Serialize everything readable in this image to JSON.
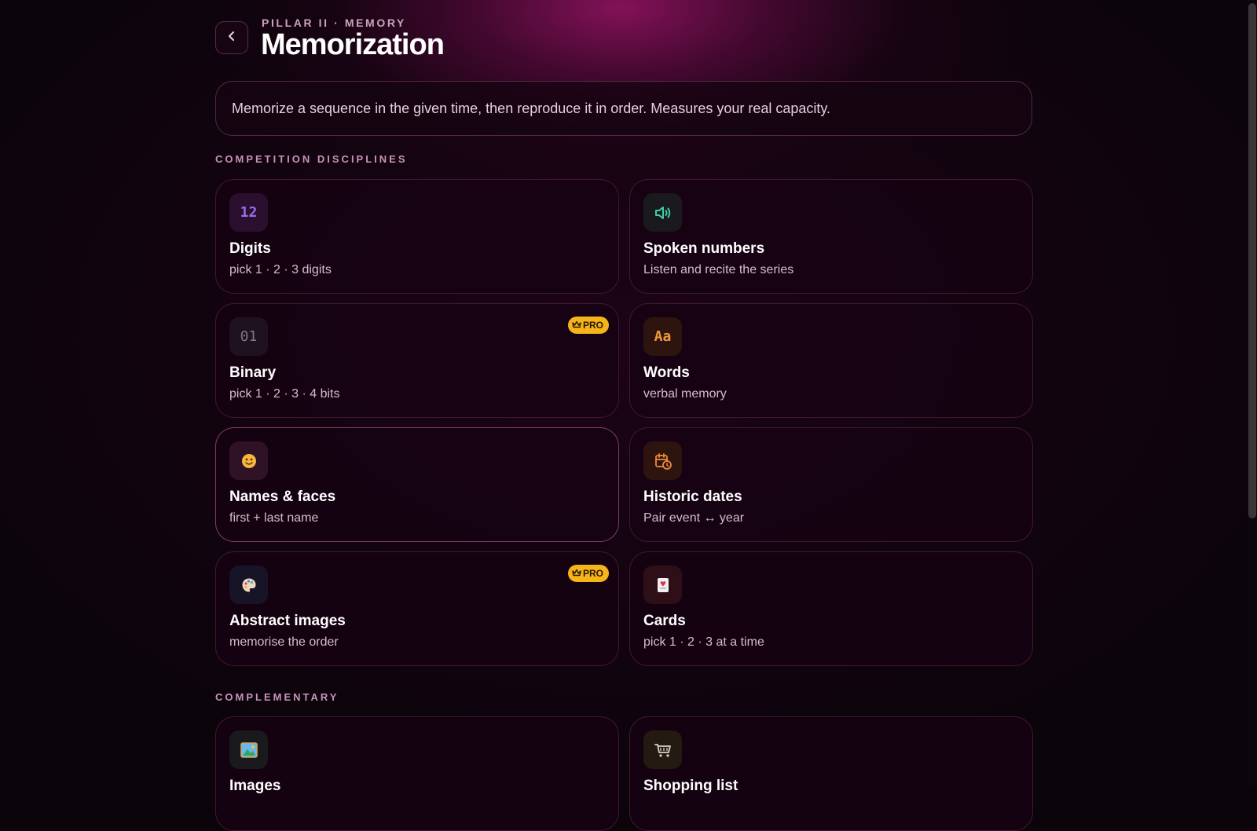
{
  "header": {
    "eyebrow": "PILLAR II · MEMORY",
    "title": "Memorization",
    "description": "Memorize a sequence in the given time, then reproduce it in order. Measures your real capacity."
  },
  "sections": {
    "competition_label": "COMPETITION DISCIPLINES",
    "complementary_label": "COMPLEMENTARY"
  },
  "pro_label": "PRO",
  "disciplines": {
    "digits": {
      "icon": "12",
      "icon_name": "digits-icon",
      "name": "Digits",
      "subtitle": "pick 1 · 2 · 3 digits",
      "color": "#9b6cf0"
    },
    "spoken": {
      "icon_name": "speaker-icon",
      "name": "Spoken numbers",
      "subtitle": "Listen and recite the series",
      "color": "#3fd0a5"
    },
    "binary": {
      "icon": "01",
      "icon_name": "binary-icon",
      "name": "Binary",
      "subtitle": "pick 1 · 2 · 3 · 4 bits",
      "pro": true,
      "color": "#7d7782"
    },
    "words": {
      "icon": "Aa",
      "icon_name": "letters-icon",
      "name": "Words",
      "subtitle": "verbal memory",
      "color": "#f09a3e"
    },
    "names": {
      "icon_name": "smiley-face-icon",
      "name": "Names & faces",
      "subtitle": "first + last name"
    },
    "dates": {
      "icon_name": "calendar-clock-icon",
      "name": "Historic dates",
      "subtitle": "Pair event ↔ year",
      "color": "#f08a3a"
    },
    "abstract": {
      "icon_name": "palette-icon",
      "name": "Abstract images",
      "subtitle": "memorise the order",
      "pro": true
    },
    "cards": {
      "icon_name": "playing-card-icon",
      "name": "Cards",
      "subtitle": "pick 1 · 2 · 3 at a time"
    }
  },
  "complementary": {
    "images": {
      "icon_name": "framed-picture-icon",
      "name": "Images"
    },
    "shopping": {
      "icon_name": "shopping-cart-icon",
      "name": "Shopping list"
    }
  }
}
